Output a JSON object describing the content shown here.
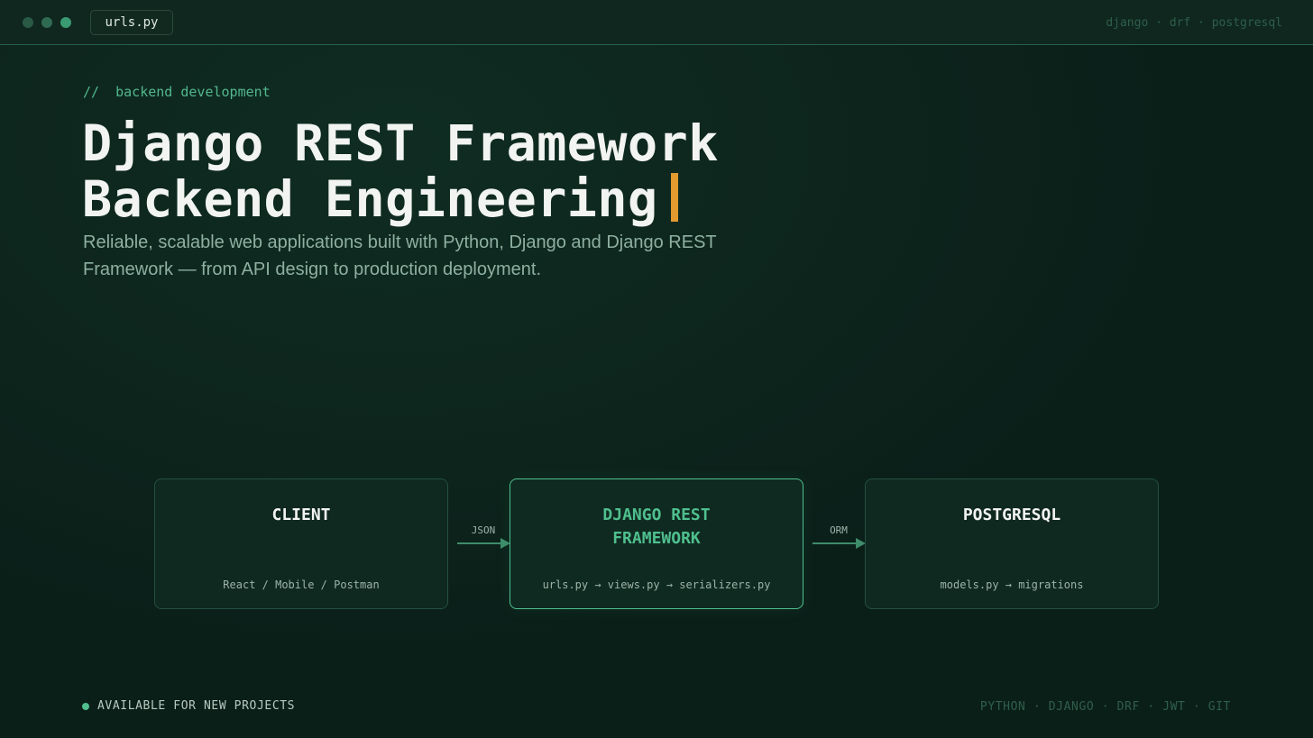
{
  "window": {
    "file_tab": "urls.py",
    "stack_text": "django · drf · postgresql"
  },
  "hero": {
    "eyebrow": "//  backend development",
    "headline_line1": "Django REST Framework",
    "headline_line2": "Backend Engineering",
    "subtitle": "Reliable, scalable web applications built with Python, Django and Django REST Framework — from API design to production deployment."
  },
  "diagram": {
    "nodes": [
      {
        "title": "CLIENT",
        "subtitle": "React / Mobile / Postman"
      },
      {
        "title": "DJANGO REST\nFRAMEWORK",
        "subtitle": "urls.py → views.py → serializers.py"
      },
      {
        "title": "POSTGRESQL",
        "subtitle": "models.py → migrations"
      }
    ],
    "connectors": [
      {
        "label": "JSON"
      },
      {
        "label": "ORM"
      }
    ]
  },
  "footer": {
    "status": "AVAILABLE FOR NEW PROJECTS",
    "tech_stack": "PYTHON · DJANGO · DRF · JWT · GIT"
  },
  "colors": {
    "background": "#0b1f19",
    "accent_green": "#4fbf8e",
    "caret_orange": "#e39a2e",
    "border": "#24503f"
  }
}
